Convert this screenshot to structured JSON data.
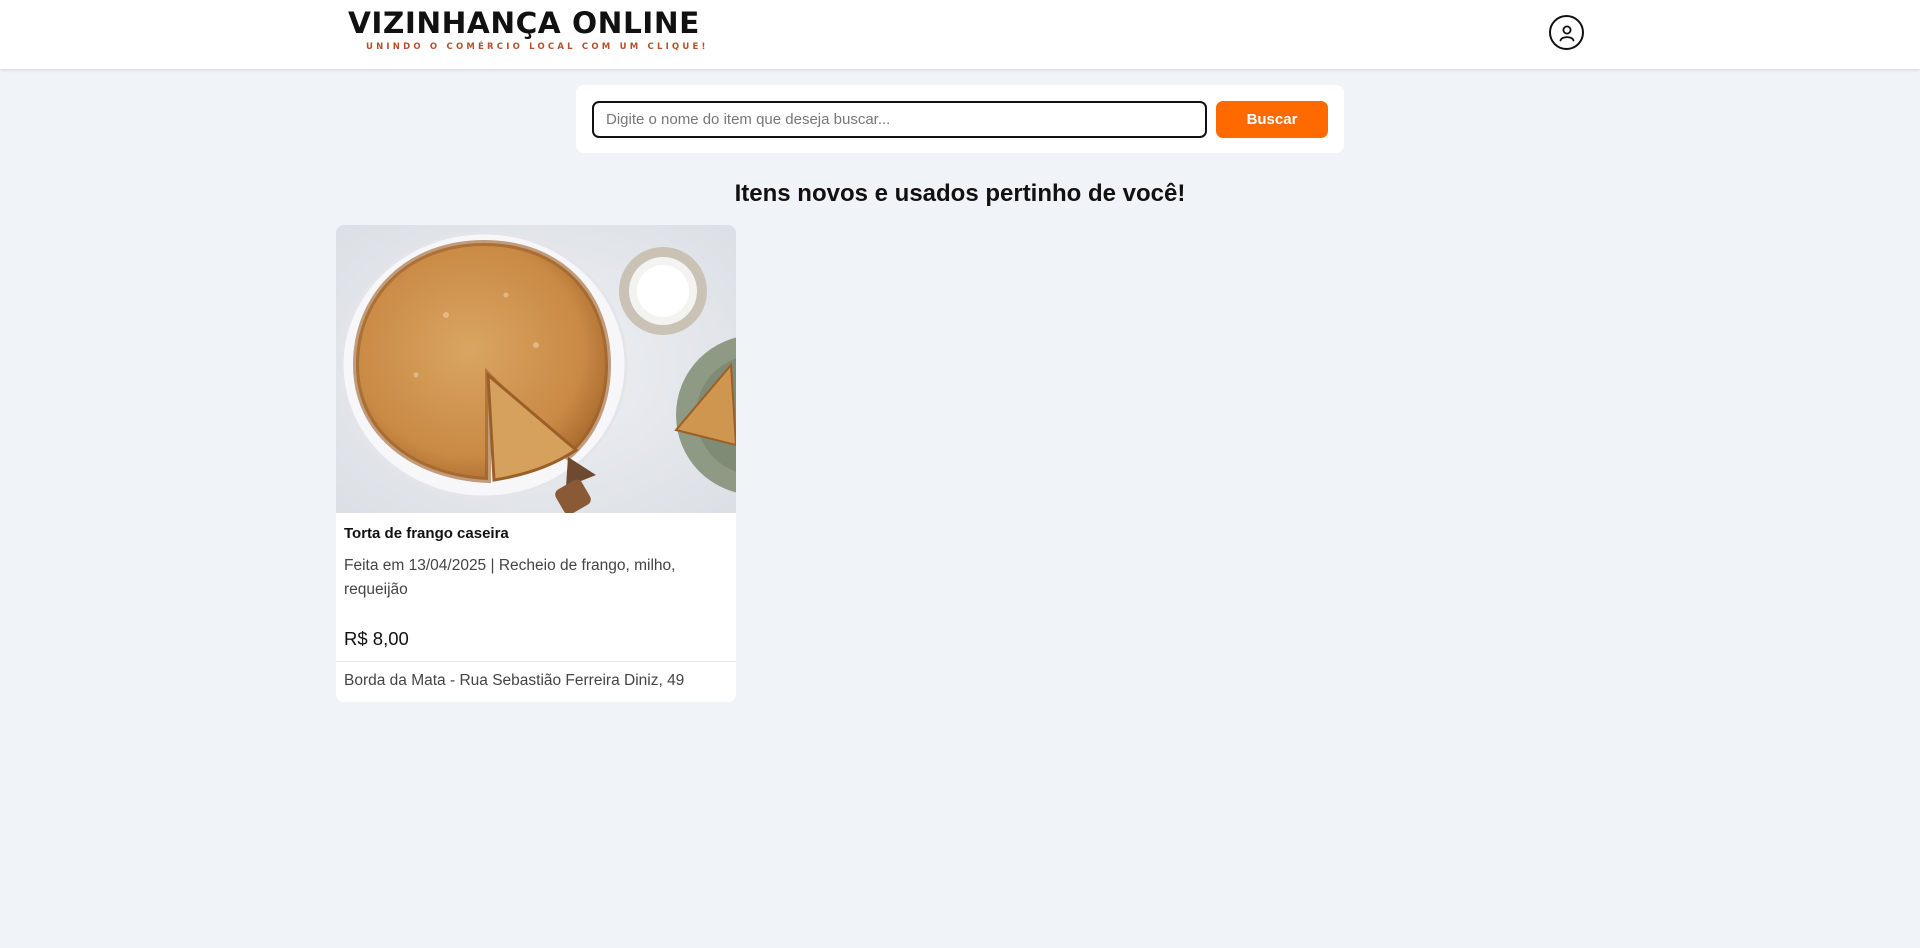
{
  "header": {
    "logo_title": "VIZINHANÇA ONLINE",
    "logo_tagline": "UNINDO O COMÉRCIO LOCAL COM UM CLIQUE!",
    "profile_icon": "user-circle-icon"
  },
  "search": {
    "placeholder": "Digite o nome do item que deseja buscar...",
    "value": "",
    "button_label": "Buscar"
  },
  "main": {
    "section_title": "Itens novos e usados pertinho de você!",
    "items": [
      {
        "title": "Torta de frango caseira",
        "description": "Feita em 13/04/2025 | Recheio de frango, milho, requeijão",
        "price": "R$ 8,00",
        "location": "Borda da Mata - Rua Sebastião Ferreira Diniz, 49"
      }
    ]
  },
  "colors": {
    "accent": "#ff6a00",
    "background": "#f0f3f8",
    "tagline": "#b5502a"
  }
}
